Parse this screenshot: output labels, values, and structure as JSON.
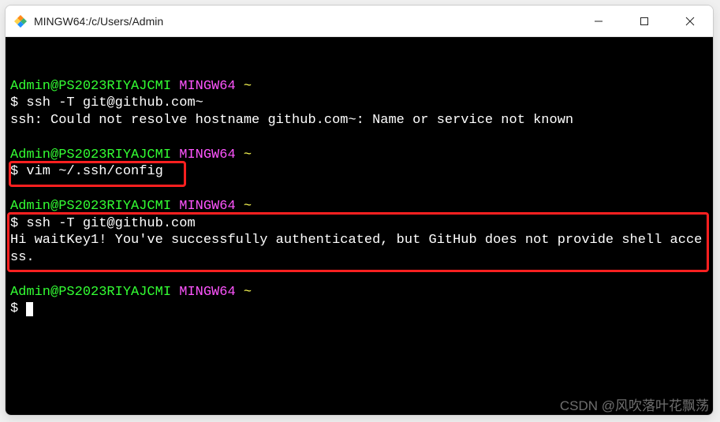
{
  "window": {
    "title": "MINGW64:/c/Users/Admin"
  },
  "prompt": {
    "userhost": "Admin@PS2023RIYAJCMI",
    "env": "MINGW64",
    "cwd": "~",
    "symbol": "$"
  },
  "blocks": [
    {
      "cmd": "ssh -T git@github.com~",
      "out": "ssh: Could not resolve hostname github.com~: Name or service not known"
    },
    {
      "cmd": "vim ~/.ssh/config",
      "out": ""
    },
    {
      "cmd": "ssh -T git@github.com",
      "out": "Hi waitKey1! You've successfully authenticated, but GitHub does not provide shell access."
    },
    {
      "cmd": "",
      "out": ""
    }
  ],
  "watermark": "CSDN @风吹落叶花飘荡"
}
